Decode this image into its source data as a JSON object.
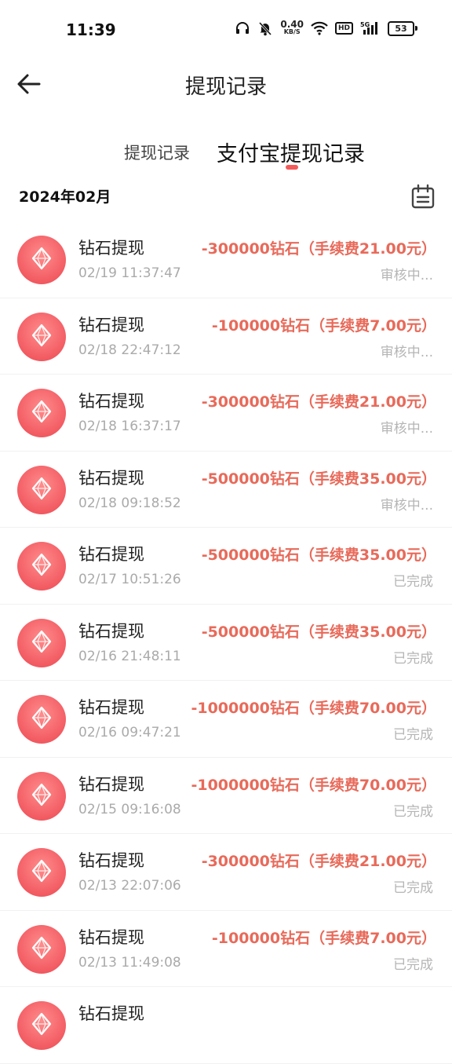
{
  "status_bar": {
    "time": "11:39",
    "net_speed_value": "0.40",
    "net_speed_unit": "KB/S",
    "hd_label": "HD",
    "network_label": "5G",
    "battery": "53"
  },
  "header": {
    "title": "提现记录",
    "back_icon": "arrow-left-icon"
  },
  "tabs": [
    {
      "label": "提现记录",
      "active": false
    },
    {
      "label": "支付宝提现记录",
      "active": true
    }
  ],
  "accent_color": "#f45a5a",
  "amount_color": "#e86a5a",
  "month": {
    "label": "2024年02月",
    "calendar_icon": "calendar-icon"
  },
  "records": [
    {
      "title": "钻石提现",
      "time": "02/19 11:37:47",
      "amount": "-300000钻石（手续费21.00元）",
      "status": "审核中..."
    },
    {
      "title": "钻石提现",
      "time": "02/18 22:47:12",
      "amount": "-100000钻石（手续费7.00元）",
      "status": "审核中..."
    },
    {
      "title": "钻石提现",
      "time": "02/18 16:37:17",
      "amount": "-300000钻石（手续费21.00元）",
      "status": "审核中..."
    },
    {
      "title": "钻石提现",
      "time": "02/18 09:18:52",
      "amount": "-500000钻石（手续费35.00元）",
      "status": "审核中..."
    },
    {
      "title": "钻石提现",
      "time": "02/17 10:51:26",
      "amount": "-500000钻石（手续费35.00元）",
      "status": "已完成"
    },
    {
      "title": "钻石提现",
      "time": "02/16 21:48:11",
      "amount": "-500000钻石（手续费35.00元）",
      "status": "已完成"
    },
    {
      "title": "钻石提现",
      "time": "02/16 09:47:21",
      "amount": "-1000000钻石（手续费70.00元）",
      "status": "已完成"
    },
    {
      "title": "钻石提现",
      "time": "02/15 09:16:08",
      "amount": "-1000000钻石（手续费70.00元）",
      "status": "已完成"
    },
    {
      "title": "钻石提现",
      "time": "02/13 22:07:06",
      "amount": "-300000钻石（手续费21.00元）",
      "status": "已完成"
    },
    {
      "title": "钻石提现",
      "time": "02/13 11:49:08",
      "amount": "-100000钻石（手续费7.00元）",
      "status": "已完成"
    },
    {
      "title": "钻石提现",
      "time": "",
      "amount": "",
      "status": ""
    }
  ]
}
